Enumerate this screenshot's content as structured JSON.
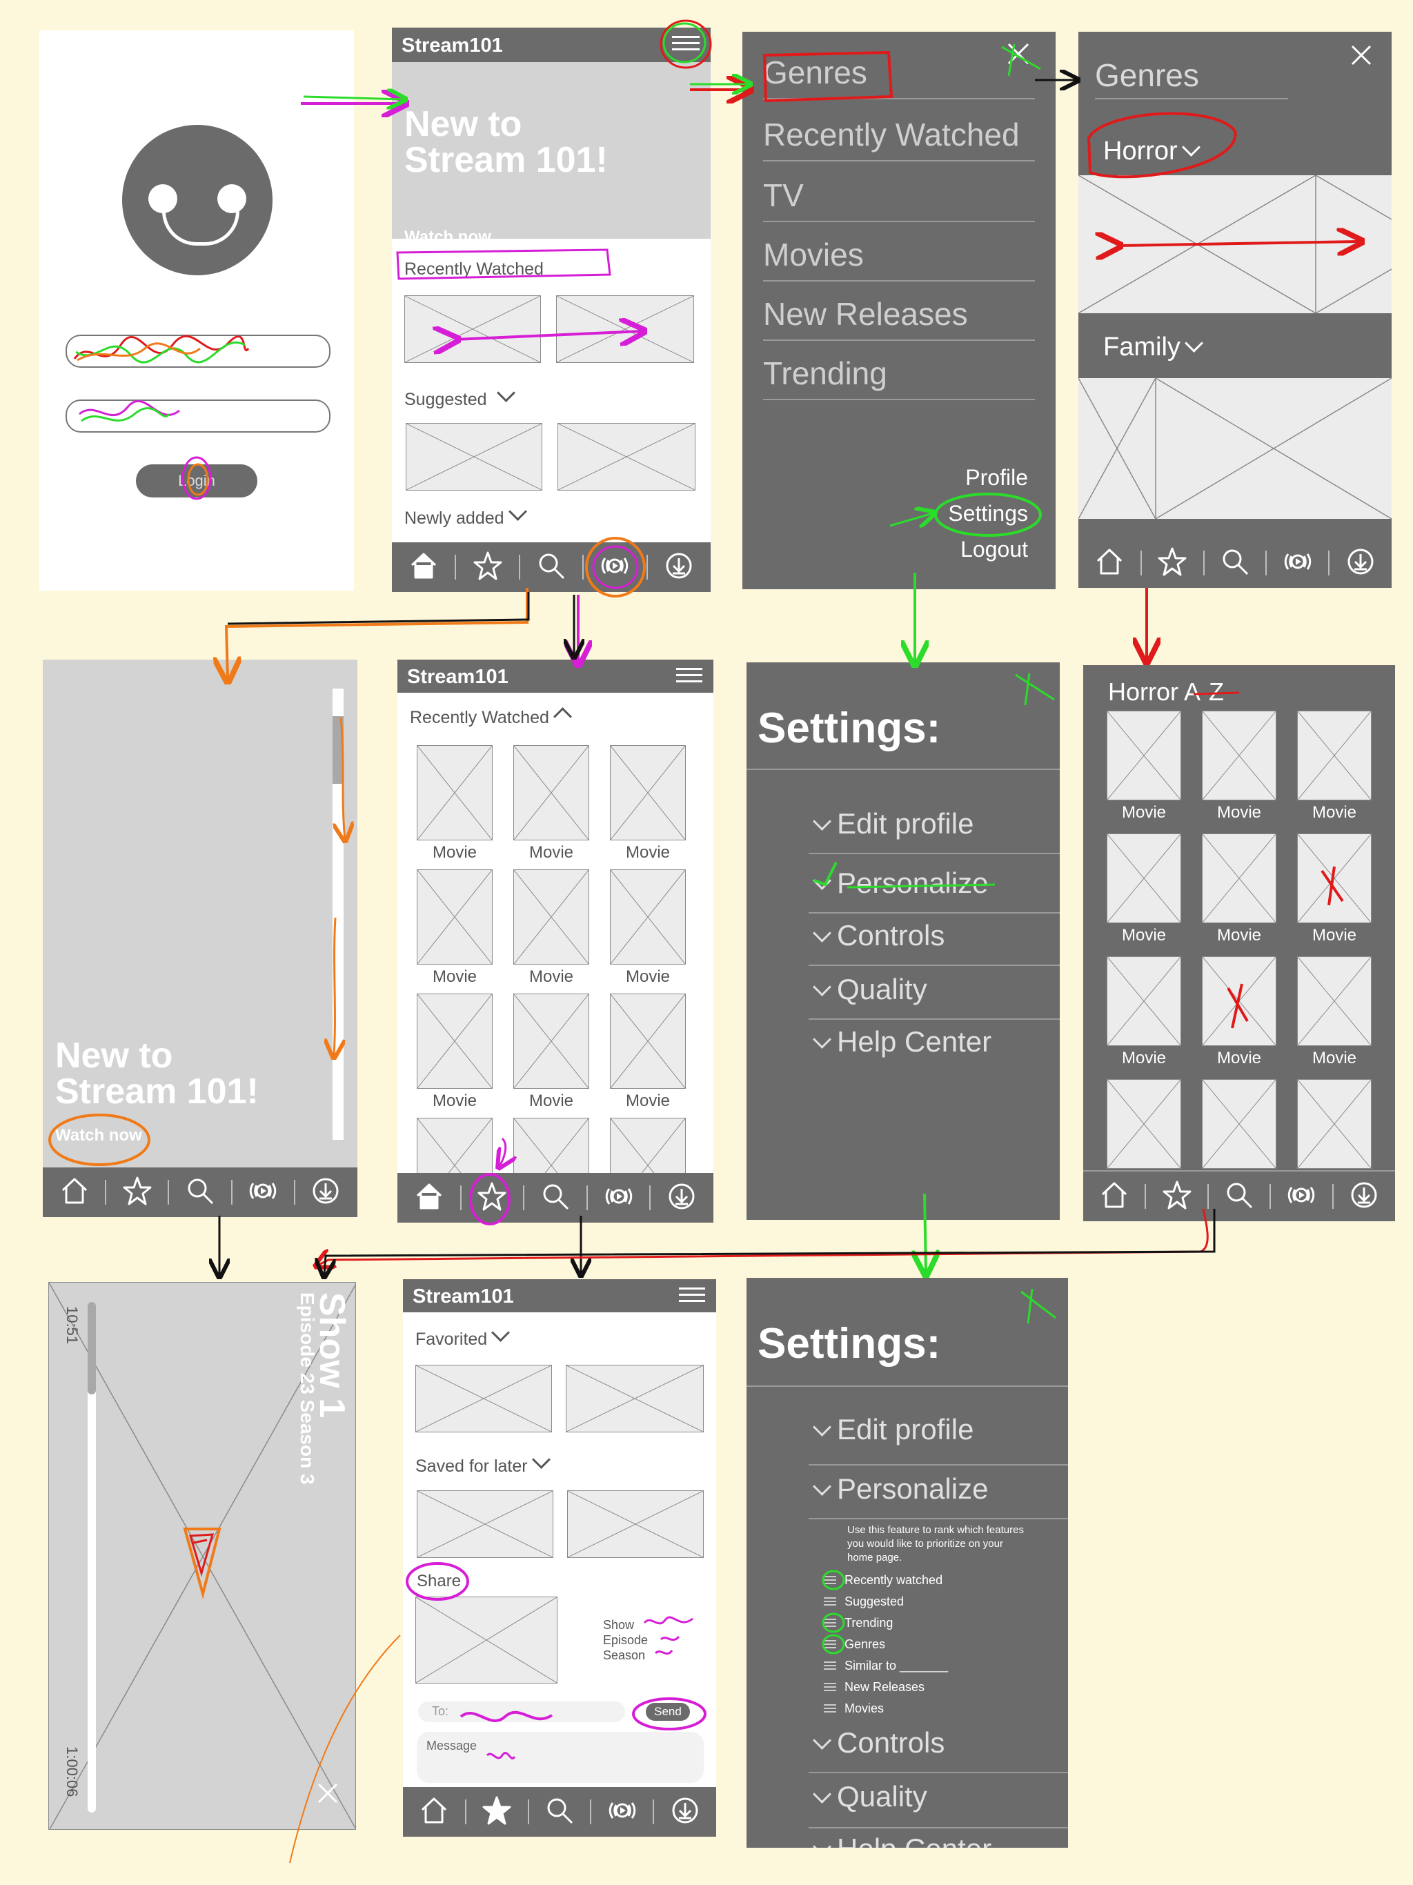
{
  "app": {
    "name": "Stream101"
  },
  "login": {
    "login_button": "Login"
  },
  "home": {
    "hero_title": "New to Stream 101!",
    "hero_cta": "Watch now",
    "sections": [
      "Recently Watched",
      "Suggested",
      "Newly added"
    ]
  },
  "menu": {
    "items": [
      "Genres",
      "Recently Watched",
      "TV",
      "Movies",
      "New Releases",
      "Trending"
    ],
    "footer": [
      "Profile",
      "Settings",
      "Logout"
    ]
  },
  "genres": {
    "title": "Genres",
    "sections": [
      "Horror",
      "Family"
    ]
  },
  "player_hero": {
    "title": "New to Stream 101!",
    "cta": "Watch now"
  },
  "recently_watched": {
    "title": "Recently Watched",
    "movie_label": "Movie"
  },
  "settings": {
    "title": "Settings:",
    "items": [
      "Edit profile",
      "Personalize",
      "Controls",
      "Quality",
      "Help Center"
    ]
  },
  "horror_az": {
    "title": "Horror A-Z",
    "movie_label": "Movie"
  },
  "video": {
    "show_title": "Show 1",
    "episode": "Episode 23 Season 3",
    "time_elapsed": "10:51",
    "time_total": "1:00:06"
  },
  "favorites": {
    "sections": [
      "Favorited",
      "Saved for later"
    ],
    "share_label": "Share",
    "share_meta": [
      "Show",
      "Episode",
      "Season"
    ],
    "to_label": "To:",
    "send_label": "Send",
    "message_label": "Message"
  },
  "settings_expanded": {
    "title": "Settings:",
    "items": [
      "Edit profile",
      "Personalize",
      "Controls",
      "Quality",
      "Help Center"
    ],
    "description": "Use this feature to rank which features you would like to prioritize on your home page.",
    "rank_items": [
      "Recently watched",
      "Suggested",
      "Trending",
      "Genres",
      "Similar to _______",
      "New Releases",
      "Movies"
    ]
  },
  "colors": {
    "background": "#fdf8dc",
    "panel": "#6b6b6b",
    "placeholder": "#ececec",
    "green": "#2bdc2b",
    "magenta": "#d61ed6",
    "orange": "#f07a18",
    "red": "#e01a1a"
  }
}
